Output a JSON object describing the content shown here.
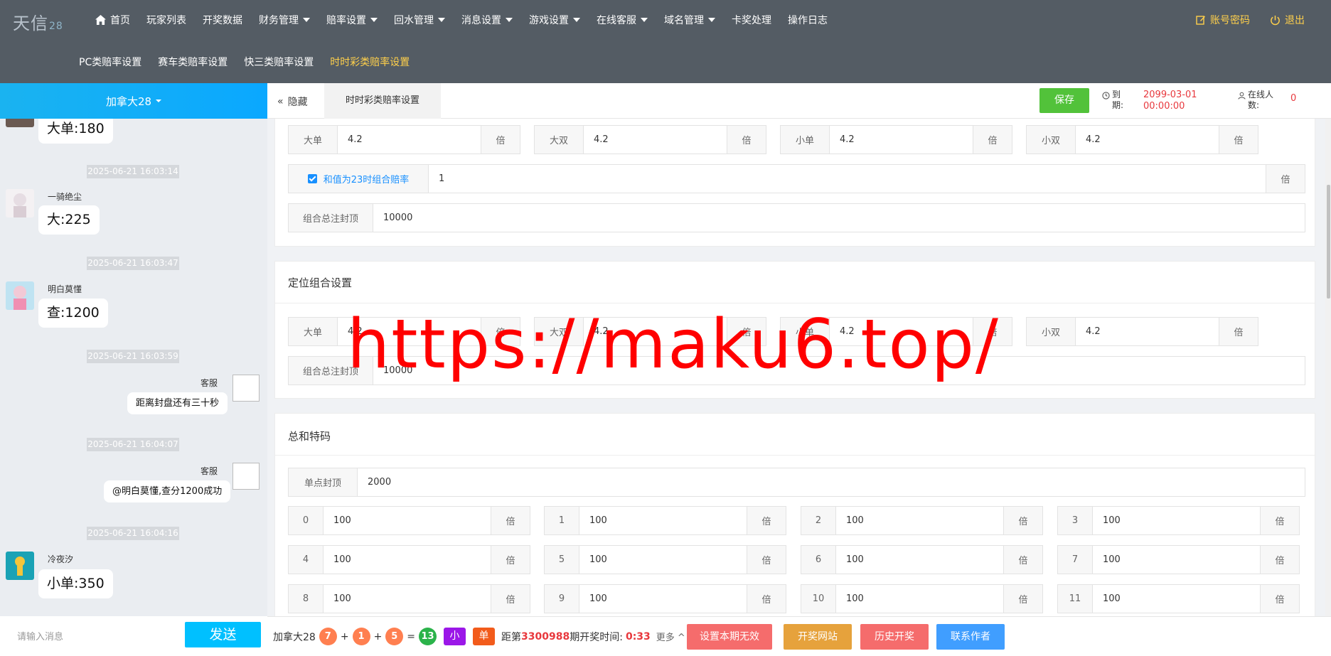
{
  "app": {
    "logo": "天信",
    "logo_suffix": "28"
  },
  "nav": {
    "items": [
      {
        "label": "首页",
        "icon": "home-icon"
      },
      {
        "label": "玩家列表"
      },
      {
        "label": "开奖数据"
      },
      {
        "label": "财务管理",
        "dropdown": true
      },
      {
        "label": "赔率设置",
        "dropdown": true
      },
      {
        "label": "回水管理",
        "dropdown": true
      },
      {
        "label": "消息设置",
        "dropdown": true
      },
      {
        "label": "游戏设置",
        "dropdown": true
      },
      {
        "label": "在线客服",
        "dropdown": true
      },
      {
        "label": "域名管理",
        "dropdown": true
      },
      {
        "label": "卡奖处理"
      },
      {
        "label": "操作日志"
      }
    ]
  },
  "subnav": {
    "items": [
      "PC类赔率设置",
      "赛车类赔率设置",
      "快三类赔率设置",
      "时时彩类赔率设置"
    ],
    "active_index": 3
  },
  "topright": {
    "account": "账号密码",
    "logout": "退出"
  },
  "left": {
    "game": "加拿大28",
    "messages": [
      {
        "text": "大单:180"
      },
      {
        "time": "2025-06-21 16:03:14",
        "name": "一骑绝尘",
        "text": "大:225"
      },
      {
        "time": "2025-06-21 16:03:47",
        "name": "明白莫懂",
        "text": "查:1200"
      },
      {
        "time": "2025-06-21 16:03:59",
        "name": "客服",
        "text": "距离封盘还有三十秒"
      },
      {
        "time": "2025-06-21 16:04:07",
        "name": "客服",
        "text": "@明白莫懂,查分1200成功"
      },
      {
        "time": "2025-06-21 16:04:16",
        "name": "冷夜汐",
        "text": "小单:350"
      }
    ],
    "input_placeholder": "请输入消息",
    "send": "发送"
  },
  "tabs": {
    "hide": "隐藏",
    "current": "时时彩类赔率设置"
  },
  "header": {
    "save": "保存",
    "expiry_label": "到期:",
    "expiry_value": "2099-03-01 00:00:00",
    "online_label": "在线人数:",
    "online_value": "0"
  },
  "section1": {
    "odds": [
      {
        "label": "大单",
        "value": "4.2",
        "unit": "倍"
      },
      {
        "label": "大双",
        "value": "4.2",
        "unit": "倍"
      },
      {
        "label": "小单",
        "value": "4.2",
        "unit": "倍"
      },
      {
        "label": "小双",
        "value": "4.2",
        "unit": "倍"
      }
    ],
    "checkbox_label": "和值为23时组合赔率",
    "checkbox_checked": true,
    "checkbox_value": "1",
    "checkbox_unit": "倍",
    "cap_label": "组合总注封顶",
    "cap_value": "10000"
  },
  "section2": {
    "title": "定位组合设置",
    "odds": [
      {
        "label": "大单",
        "value": "4.2",
        "unit": "倍"
      },
      {
        "label": "大双",
        "value": "4.2",
        "unit": "倍"
      },
      {
        "label": "小单",
        "value": "4.2",
        "unit": "倍"
      },
      {
        "label": "小双",
        "value": "4.2",
        "unit": "倍"
      }
    ],
    "cap_label": "组合总注封顶",
    "cap_value": "10000"
  },
  "section3": {
    "title": "总和特码",
    "cap_label": "单点封顶",
    "cap_value": "2000",
    "items": [
      {
        "label": "0",
        "value": "100",
        "unit": "倍"
      },
      {
        "label": "1",
        "value": "100",
        "unit": "倍"
      },
      {
        "label": "2",
        "value": "100",
        "unit": "倍"
      },
      {
        "label": "3",
        "value": "100",
        "unit": "倍"
      },
      {
        "label": "4",
        "value": "100",
        "unit": "倍"
      },
      {
        "label": "5",
        "value": "100",
        "unit": "倍"
      },
      {
        "label": "6",
        "value": "100",
        "unit": "倍"
      },
      {
        "label": "7",
        "value": "100",
        "unit": "倍"
      },
      {
        "label": "8",
        "value": "100",
        "unit": "倍"
      },
      {
        "label": "9",
        "value": "100",
        "unit": "倍"
      },
      {
        "label": "10",
        "value": "100",
        "unit": "倍"
      },
      {
        "label": "11",
        "value": "100",
        "unit": "倍"
      }
    ]
  },
  "bottom": {
    "game": "加拿大28",
    "balls": [
      "7",
      "1",
      "5"
    ],
    "plus": "+",
    "equals": "=",
    "sum": "13",
    "size": "小",
    "parity": "单",
    "period_prefix": "距第",
    "period": "3300988",
    "period_suffix": "期开奖时间:",
    "countdown": "0:33",
    "more": "更多",
    "buttons": [
      "设置本期无效",
      "开奖网站",
      "历史开奖",
      "联系作者"
    ]
  },
  "watermark": "https://maku6.top/",
  "colors": {
    "topbar": "#545c64",
    "active": "#ffd04b",
    "save": "#52c23a",
    "send": "#00c0ff",
    "danger": "#e8383d"
  }
}
